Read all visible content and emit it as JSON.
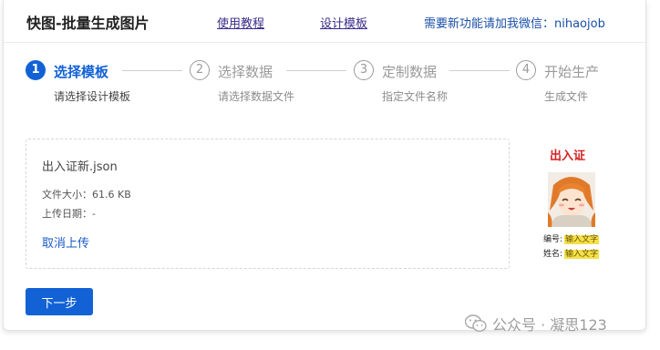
{
  "header": {
    "title": "快图-批量生成图片",
    "tutorial_link": "使用教程",
    "template_link": "设计模板",
    "wechat_note": "需要新功能请加我微信：nihaojob"
  },
  "steps": [
    {
      "number": "1",
      "title": "选择模板",
      "subtitle": "请选择设计模板",
      "active": true
    },
    {
      "number": "2",
      "title": "选择数据",
      "subtitle": "请选择数据文件",
      "active": false
    },
    {
      "number": "3",
      "title": "定制数据",
      "subtitle": "指定文件名称",
      "active": false
    },
    {
      "number": "4",
      "title": "开始生产",
      "subtitle": "生成文件",
      "active": false
    }
  ],
  "upload": {
    "file_name": "出入证新.json",
    "file_size": "文件大小：61.6 KB",
    "upload_date": "上传日期：-",
    "cancel_label": "取消上传"
  },
  "preview": {
    "title": "出入证",
    "fields": [
      {
        "label": "编号:",
        "value": "输入文字"
      },
      {
        "label": "姓名:",
        "value": "输入文字"
      }
    ]
  },
  "actions": {
    "next_label": "下一步"
  },
  "watermark": "公众号 · 凝思123",
  "colors": {
    "primary": "#1262d6",
    "link": "#3a2c8a",
    "preview_title": "#d62020",
    "highlight": "#f5e04a"
  }
}
